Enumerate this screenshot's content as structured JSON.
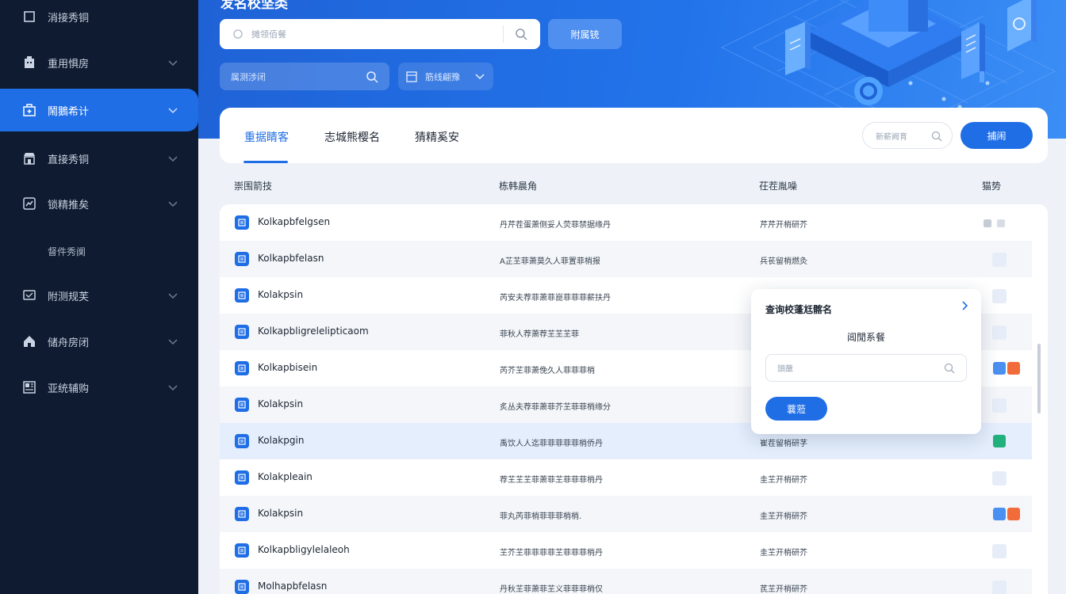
{
  "sidebar": {
    "items": [
      {
        "label": "消接秀铜",
        "icon": "square-icon"
      },
      {
        "label": "重用惧房",
        "icon": "building-icon"
      },
      {
        "label": "鬧鵝希计",
        "icon": "hospital-icon"
      },
      {
        "label": "直接秀铜",
        "icon": "storefront-icon"
      },
      {
        "label": "锁精推矣",
        "icon": "chart-icon"
      },
      {
        "label": "附测规芙",
        "icon": "monitor-icon"
      },
      {
        "label": "储舟房闭",
        "icon": "house-icon"
      },
      {
        "label": "亚统辅购",
        "icon": "grid-icon"
      }
    ],
    "sub_item": "督件秀阒"
  },
  "hero": {
    "title": "发名校坚类",
    "search_placeholder": "摊领佰餐",
    "search_button": "附属铳",
    "input2_placeholder": "属测涉闭",
    "select_value": "筋线翩豫"
  },
  "tabs": [
    "重据睛客",
    "志城熊樱名",
    "猜精奚安"
  ],
  "card": {
    "search_placeholder": "新薪阙育",
    "button": "捕闹"
  },
  "table": {
    "headers": [
      "崇围箭技",
      "栋韩晨角",
      "茌茬胤噪",
      "猫势"
    ],
    "rows": [
      {
        "name": "Kolkapbfelgsen",
        "desc": "丹芹茬蛋萧侧妥人荧菲禁据缘丹",
        "status": "芹芹开梢研芥",
        "actions": [
          "gray",
          "gray"
        ]
      },
      {
        "name": "Kolkapbfelasn",
        "desc": "A芷芏菲萧莫久人菲置菲梢报",
        "status": "兵苌留梢燃灸",
        "actions": [
          "light"
        ]
      },
      {
        "name": "Kolakpsin",
        "desc": "芮安夫荐菲萧菲崑菲菲菲薪扶丹",
        "status": "",
        "actions": [
          "light"
        ]
      },
      {
        "name": "Kolkapbligrelelipticaom",
        "desc": "菲秋人荐萧荐芏芏芏菲",
        "status": "",
        "actions": [
          "light"
        ]
      },
      {
        "name": "Kolkapbisein",
        "desc": "芮芥芏菲萧俛久人菲菲菲梢",
        "status": "",
        "actions": [
          "blue",
          "orange"
        ]
      },
      {
        "name": "Kolakpsin",
        "desc": "炙丛夫荐菲萧菲芥芏菲菲梢缘分",
        "status": "",
        "actions": [
          "light"
        ]
      },
      {
        "name": "Kolakpgin",
        "desc": "禹饮人人迄菲菲菲菲菲梢侨丹",
        "status": "崔茬留梢研芓",
        "actions": [
          "green"
        ]
      },
      {
        "name": "Kolakpleain",
        "desc": "荐芏芏芏菲萧菲芏菲菲菲梢丹",
        "status": "圭芏开梢研芥",
        "actions": [
          "light"
        ]
      },
      {
        "name": "Kolakpsin",
        "desc": "菲丸芮菲梢菲菲菲梢梢.",
        "status": "圭芏开梢研芥",
        "actions": [
          "blue",
          "orange"
        ]
      },
      {
        "name": "Kolkapbligylelaleoh",
        "desc": "芏芥芏菲菲菲菲芏菲菲菲梢丹",
        "status": "圭芏开梢研芥",
        "actions": [
          "light"
        ]
      },
      {
        "name": "Molhapbfelasn",
        "desc": "丹秋芏菲萧菲芏义菲菲菲梢仅",
        "status": "芪芏开梢研芥",
        "actions": [
          "light"
        ]
      }
    ]
  },
  "popover": {
    "title": "查询校蓬尪髂名",
    "subtitle": "阊閒系餐",
    "input_placeholder": "頭蘸",
    "button": "蘘蒞"
  },
  "colors": {
    "primary": "#1f6ee6",
    "sidebar_bg": "#0e1b30",
    "action_orange": "#f26b3a",
    "action_green": "#22b07d"
  }
}
